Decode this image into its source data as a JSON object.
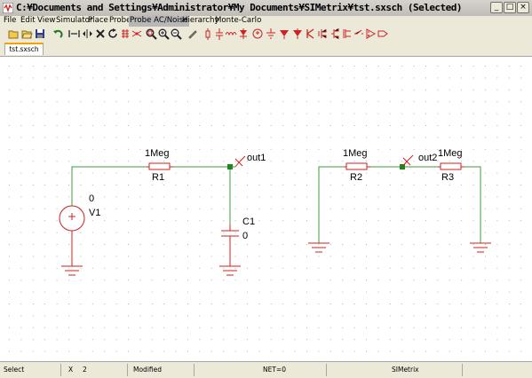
{
  "window": {
    "title": "C:¥Documents and Settings¥Administrator¥My Documents¥SIMetrix¥tst.sxsch (Selected)"
  },
  "window_buttons": {
    "minimize": "_",
    "maximize": "□",
    "close": "×"
  },
  "menus": [
    "File",
    "Edit",
    "View",
    "Simulator",
    "Place",
    "Probe",
    "Probe AC/Noise",
    "Hierarchy",
    "Monte-Carlo"
  ],
  "toolbar_icons": [
    "open-icon",
    "folder-icon",
    "save-icon",
    "undo-icon",
    "cut-wire-icon",
    "mirror-icon",
    "delete-icon",
    "rotate-icon",
    "zoom-fit-icon",
    "zoom-in-icon",
    "zoom-out-icon",
    "zoom-box-icon",
    "pen-icon",
    "resistor-icon",
    "capacitor-icon",
    "inductor-icon",
    "diode-icon",
    "voltage-source-icon",
    "ground-icon",
    "npn-icon",
    "pnp-icon",
    "nmos-icon",
    "pmos-icon",
    "opamp-icon",
    "probe-icon",
    "terminal-icon"
  ],
  "tab": {
    "label": "tst.sxsch"
  },
  "schematic": {
    "components": [
      {
        "ref": "R1",
        "value": "1Meg"
      },
      {
        "ref": "R2",
        "value": "1Meg"
      },
      {
        "ref": "R3",
        "value": "1Meg"
      },
      {
        "ref": "C1",
        "value": "0"
      },
      {
        "ref": "V1",
        "value": "0"
      }
    ],
    "probes": [
      "out1",
      "out2"
    ]
  },
  "status": {
    "mode": "Select",
    "x_label": "X",
    "x_value": "2",
    "modified": "Modified",
    "net": "NET=0",
    "app": "SIMetrix"
  },
  "colors": {
    "wire": "#3c9b3c",
    "component": "#cc2222",
    "junction": "#1a8a1a",
    "grid_dot": "#b0b0b0"
  }
}
